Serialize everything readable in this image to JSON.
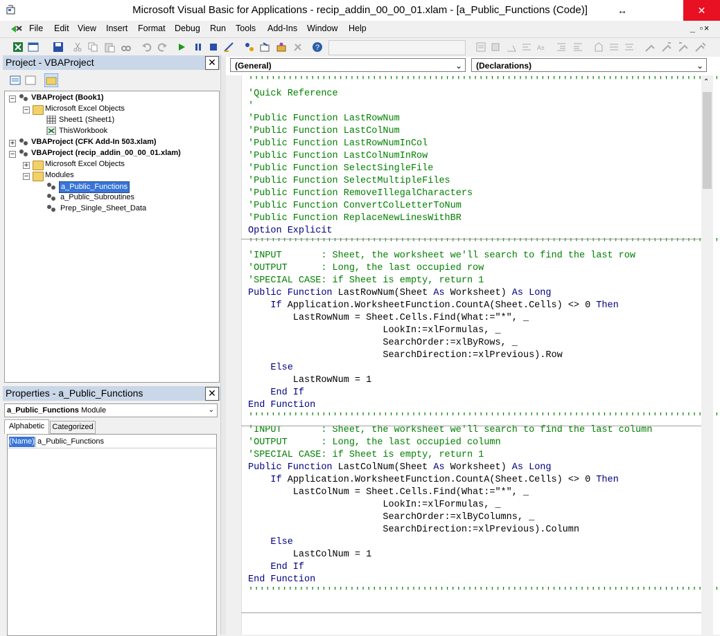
{
  "window": {
    "title": "Microsoft Visual Basic for Applications - recip_addin_00_00_01.xlam - [a_Public_Functions (Code)]"
  },
  "menubar": {
    "items": [
      "File",
      "Edit",
      "View",
      "Insert",
      "Format",
      "Debug",
      "Run",
      "Tools",
      "Add-Ins",
      "Window",
      "Help"
    ]
  },
  "project": {
    "title": "Project - VBAProject",
    "nodes": [
      {
        "label": "VBAProject (Book1)"
      },
      {
        "label": "Microsoft Excel Objects"
      },
      {
        "label": "Sheet1 (Sheet1)"
      },
      {
        "label": "ThisWorkbook"
      },
      {
        "label": "VBAProject (CFK Add-In 503.xlam)"
      },
      {
        "label": "VBAProject (recip_addin_00_00_01.xlam)"
      },
      {
        "label": "Microsoft Excel Objects"
      },
      {
        "label": "Modules"
      },
      {
        "label": "a_Public_Functions"
      },
      {
        "label": "a_Public_Subroutines"
      },
      {
        "label": "Prep_Single_Sheet_Data"
      }
    ]
  },
  "properties": {
    "title": "Properties - a_Public_Functions",
    "object_name": "a_Public_Functions",
    "object_type": "Module",
    "tabs": [
      "Alphabetic",
      "Categorized"
    ],
    "prop_name": "(Name)",
    "prop_value": "a_Public_Functions"
  },
  "code": {
    "object_combo": "(General)",
    "proc_combo": "(Declarations)",
    "lines": [
      {
        "t": "cm",
        "s": "''''''''''''''''''''''''''''''''''''''''''''''''''''''''''''''''''''''''''''''''''''"
      },
      {
        "t": "cm",
        "s": "'Quick Reference"
      },
      {
        "t": "cm",
        "s": "'"
      },
      {
        "t": "cm",
        "s": "'Public Function LastRowNum"
      },
      {
        "t": "cm",
        "s": "'Public Function LastColNum"
      },
      {
        "t": "cm",
        "s": "'Public Function LastRowNumInCol"
      },
      {
        "t": "cm",
        "s": "'Public Function LastColNumInRow"
      },
      {
        "t": "cm",
        "s": "'Public Function SelectSingleFile"
      },
      {
        "t": "cm",
        "s": "'Public Function SelectMultipleFiles"
      },
      {
        "t": "cm",
        "s": "'Public Function RemoveIllegalCharacters"
      },
      {
        "t": "cm",
        "s": "'Public Function ConvertColLetterToNum"
      },
      {
        "t": "cm",
        "s": "'Public Function ReplaceNewLinesWithBR"
      },
      {
        "t": "kw",
        "s": "Option Explicit"
      },
      {
        "t": "cm",
        "s": "''''''''''''''''''''''''''''''''''''''''''''''''''''''''''''''''''''''''''''''''''''"
      },
      {
        "t": "cm",
        "s": "'INPUT       : Sheet, the worksheet we'll search to find the last row"
      },
      {
        "t": "cm",
        "s": "'OUTPUT      : Long, the last occupied row"
      },
      {
        "t": "cm",
        "s": "'SPECIAL CASE: if Sheet is empty, return 1"
      },
      {
        "t": "mx",
        "p": [
          [
            "kw",
            "Public Function "
          ],
          [
            "tx",
            "LastRowNum(Sheet "
          ],
          [
            "kw",
            "As "
          ],
          [
            "tx",
            "Worksheet) "
          ],
          [
            "kw",
            "As Long"
          ]
        ]
      },
      {
        "t": "mx",
        "p": [
          [
            "kw",
            "    If "
          ],
          [
            "tx",
            "Application.WorksheetFunction.CountA(Sheet.Cells) <> 0 "
          ],
          [
            "kw",
            "Then"
          ]
        ]
      },
      {
        "t": "tx",
        "s": "        LastRowNum = Sheet.Cells.Find(What:=\"*\", _"
      },
      {
        "t": "tx",
        "s": "                        LookIn:=xlFormulas, _"
      },
      {
        "t": "tx",
        "s": "                        SearchOrder:=xlByRows, _"
      },
      {
        "t": "tx",
        "s": "                        SearchDirection:=xlPrevious).Row"
      },
      {
        "t": "kw",
        "s": "    Else"
      },
      {
        "t": "tx",
        "s": "        LastRowNum = 1"
      },
      {
        "t": "kw",
        "s": "    End If"
      },
      {
        "t": "kw",
        "s": "End Function"
      },
      {
        "t": "cm",
        "s": "''''''''''''''''''''''''''''''''''''''''''''''''''''''''''''''''''''''''''''''''''''"
      },
      {
        "t": "cm",
        "s": "'INPUT       : Sheet, the worksheet we'll search to find the last column"
      },
      {
        "t": "cm",
        "s": "'OUTPUT      : Long, the last occupied column"
      },
      {
        "t": "cm",
        "s": "'SPECIAL CASE: if Sheet is empty, return 1"
      },
      {
        "t": "mx",
        "p": [
          [
            "kw",
            "Public Function "
          ],
          [
            "tx",
            "LastColNum(Sheet "
          ],
          [
            "kw",
            "As "
          ],
          [
            "tx",
            "Worksheet) "
          ],
          [
            "kw",
            "As Long"
          ]
        ]
      },
      {
        "t": "mx",
        "p": [
          [
            "kw",
            "    If "
          ],
          [
            "tx",
            "Application.WorksheetFunction.CountA(Sheet.Cells) <> 0 "
          ],
          [
            "kw",
            "Then"
          ]
        ]
      },
      {
        "t": "tx",
        "s": "        LastColNum = Sheet.Cells.Find(What:=\"*\", _"
      },
      {
        "t": "tx",
        "s": "                        LookIn:=xlFormulas, _"
      },
      {
        "t": "tx",
        "s": "                        SearchOrder:=xlByColumns, _"
      },
      {
        "t": "tx",
        "s": "                        SearchDirection:=xlPrevious).Column"
      },
      {
        "t": "kw",
        "s": "    Else"
      },
      {
        "t": "tx",
        "s": "        LastColNum = 1"
      },
      {
        "t": "kw",
        "s": "    End If"
      },
      {
        "t": "kw",
        "s": "End Function"
      },
      {
        "t": "cm",
        "s": "''''''''''''''''''''''''''''''''''''''''''''''''''''''''''''''''''''''''''''''''''''"
      }
    ]
  },
  "colors": {
    "keyword": "#00007f",
    "comment": "#007f00",
    "pane_header": "#c9d7e8",
    "selection": "#3875d7",
    "close_button": "#e81123"
  }
}
